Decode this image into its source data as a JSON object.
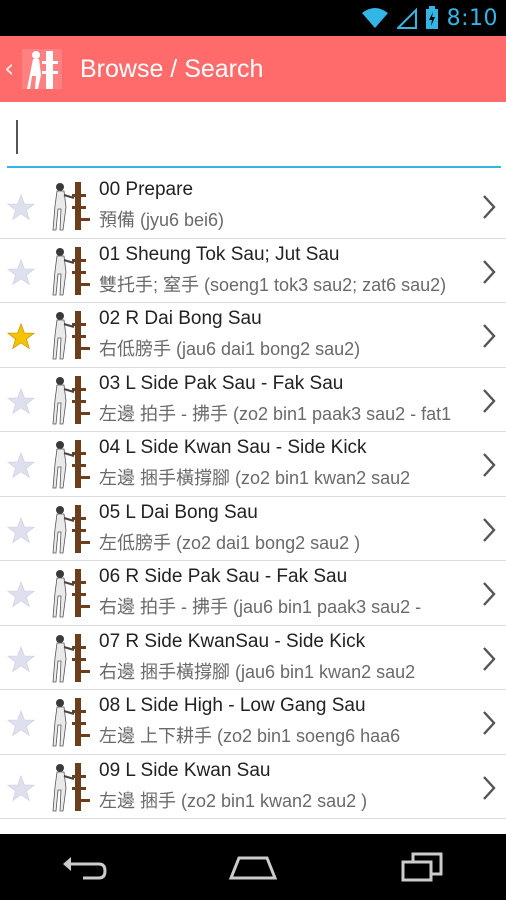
{
  "status": {
    "time": "8:10"
  },
  "header": {
    "title": "Browse / Search"
  },
  "search": {
    "value": "",
    "placeholder": ""
  },
  "colors": {
    "accent": "#33b5e5",
    "header": "#ff6a6a",
    "star_on": "#f5c400",
    "star_off": "#dfe0ee"
  },
  "items": [
    {
      "title": "00 Prepare",
      "subtitle": "預備 (jyu6 bei6)",
      "favorite": false
    },
    {
      "title": "01 Sheung Tok Sau; Jut Sau",
      "subtitle": "雙托手; 窒手 (soeng1 tok3 sau2; zat6 sau2)",
      "favorite": false
    },
    {
      "title": "02 R Dai Bong Sau",
      "subtitle": "右低膀手 (jau6 dai1 bong2 sau2)",
      "favorite": true
    },
    {
      "title": "03 L Side Pak Sau - Fak Sau",
      "subtitle": "左邊 拍手 - 拂手 (zo2 bin1 paak3 sau2 - fat1",
      "favorite": false
    },
    {
      "title": "04 L Side Kwan Sau - Side Kick",
      "subtitle": "左邊 捆手橫撐腳 (zo2 bin1 kwan2 sau2",
      "favorite": false
    },
    {
      "title": "05 L Dai Bong Sau",
      "subtitle": "左低膀手 (zo2 dai1 bong2 sau2 )",
      "favorite": false
    },
    {
      "title": "06 R Side Pak Sau - Fak Sau",
      "subtitle": "右邊 拍手 - 拂手 (jau6 bin1 paak3 sau2 -",
      "favorite": false
    },
    {
      "title": "07 R Side KwanSau - Side Kick",
      "subtitle": "右邊 捆手橫撐腳 (jau6 bin1 kwan2 sau2",
      "favorite": false
    },
    {
      "title": "08 L Side High - Low Gang Sau",
      "subtitle": "左邊 上下耕手 (zo2 bin1 soeng6 haa6",
      "favorite": false
    },
    {
      "title": "09 L Side Kwan Sau",
      "subtitle": "左邊 捆手 (zo2 bin1 kwan2 sau2 )",
      "favorite": false
    }
  ]
}
